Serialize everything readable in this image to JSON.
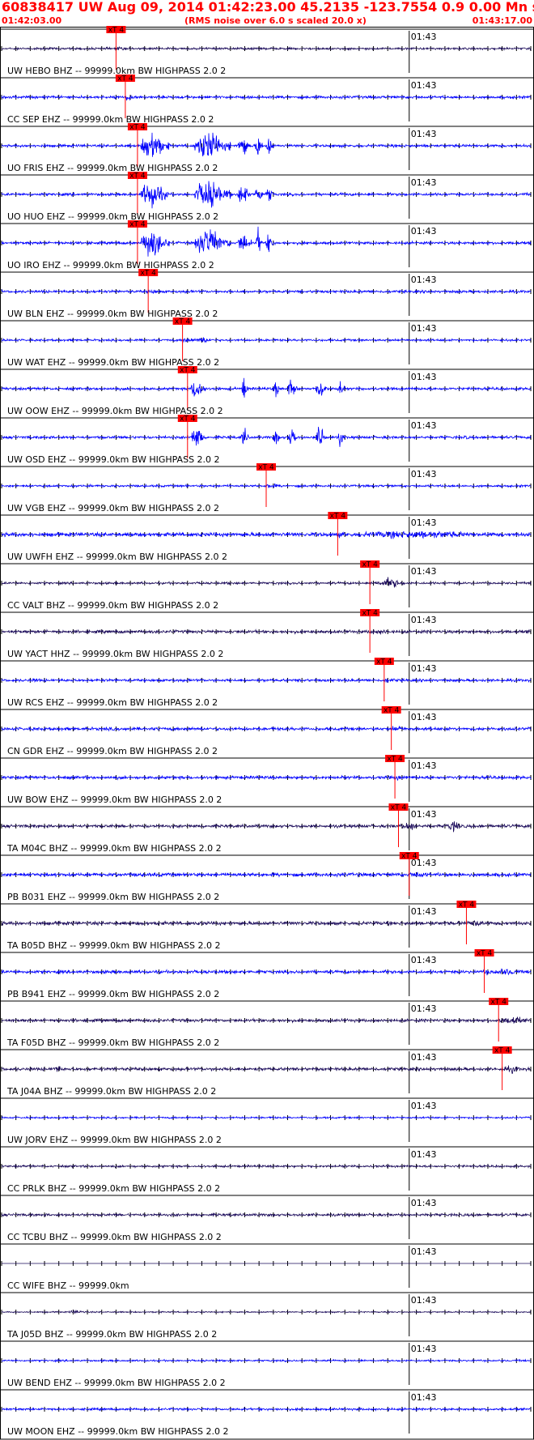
{
  "header": {
    "title": "60838417 UW Aug 09, 2014 01:42:23.00   45.2135 -123.7554  0.9 0.00 Mn st --- -- --   -1",
    "start_time": "01:42:03.00",
    "subtitle": "(RMS noise over 6.0 s scaled 20.0 x)",
    "end_time": "01:43:17.00"
  },
  "colors": {
    "header_text": "#ff0000",
    "trace_blue": "#0000ff",
    "trace_dark": "#1a0a5a",
    "pick_marker": "#ff0000",
    "grid": "#000000"
  },
  "chart_data": {
    "type": "line",
    "title": "60838417 UW Aug 09, 2014 01:42:23.00   45.2135 -123.7554  0.9 0.00 Mn st --- -- --   -1",
    "xlabel": "",
    "ylabel": "",
    "x_range_seconds": [
      0,
      74
    ],
    "x_start_label": "01:42:03.00",
    "x_end_label": "01:43:17.00",
    "minute_tick_label": "01:43",
    "minute_tick_offset_s": 57,
    "tick_spacing_s": 2,
    "grid": false,
    "pick_label": "xT 4",
    "traces": [
      {
        "label": "UW HEBO BHZ -- 99999.0km BW  HIGHPASS  2.0  2",
        "color": "dark",
        "pick_s": 16.0,
        "amp": 0.25,
        "bursts": [],
        "pick_burst": 0.2
      },
      {
        "label": "CC SEP EHZ -- 99999.0km BW  HIGHPASS  2.0  2",
        "color": "blue",
        "pick_s": 17.3,
        "amp": 0.3,
        "bursts": [],
        "pick_burst": 0.6
      },
      {
        "label": "UO FRIS EHZ -- 99999.0km BW  HIGHPASS  2.0  2",
        "color": "blue",
        "pick_s": 19.0,
        "amp": 0.3,
        "bursts": [
          [
            19.5,
            23.5,
            3.5
          ],
          [
            27,
            32,
            3.5
          ],
          [
            33,
            35,
            2.5
          ],
          [
            35.5,
            36.5,
            3
          ],
          [
            37,
            38,
            2.5
          ]
        ],
        "pick_burst": 0
      },
      {
        "label": "UO HUO EHZ -- 99999.0km BW  HIGHPASS  2.0  2",
        "color": "blue",
        "pick_s": 19.0,
        "amp": 0.3,
        "bursts": [
          [
            19.5,
            23.5,
            3.5
          ],
          [
            27,
            32,
            3.5
          ],
          [
            33,
            35,
            2.5
          ],
          [
            35.5,
            36.5,
            3
          ],
          [
            37,
            38,
            2.5
          ]
        ],
        "pick_burst": 0
      },
      {
        "label": "UO IRO EHZ -- 99999.0km BW  HIGHPASS  2.0  2",
        "color": "blue",
        "pick_s": 19.0,
        "amp": 0.3,
        "bursts": [
          [
            19.5,
            23.5,
            3.5
          ],
          [
            27,
            32,
            3.5
          ],
          [
            33,
            35,
            2.5
          ],
          [
            35.5,
            36.5,
            3
          ],
          [
            37,
            38,
            2.5
          ]
        ],
        "pick_burst": 0
      },
      {
        "label": "UW BLN EHZ -- 99999.0km BW  HIGHPASS  2.0  2",
        "color": "blue",
        "pick_s": 20.5,
        "amp": 0.3,
        "bursts": [],
        "pick_burst": 0.3
      },
      {
        "label": "UW WAT EHZ -- 99999.0km BW  HIGHPASS  2.0  2",
        "color": "blue",
        "pick_s": 25.3,
        "amp": 0.25,
        "bursts": [
          [
            27,
            30,
            0.8
          ]
        ],
        "pick_burst": 0.5
      },
      {
        "label": "UW OOW EHZ -- 99999.0km BW  HIGHPASS  2.0  2",
        "color": "blue",
        "pick_s": 26.0,
        "amp": 0.3,
        "bursts": [
          [
            26.5,
            28.5,
            3
          ],
          [
            33.5,
            34.5,
            2.5
          ],
          [
            38,
            39,
            2
          ],
          [
            40,
            41.5,
            2.5
          ],
          [
            44,
            45.5,
            3
          ],
          [
            47,
            48,
            2
          ]
        ],
        "pick_burst": 0
      },
      {
        "label": "UW OSD EHZ -- 99999.0km BW  HIGHPASS  2.0  2",
        "color": "blue",
        "pick_s": 26.0,
        "amp": 0.3,
        "bursts": [
          [
            26.5,
            28.5,
            3
          ],
          [
            33.5,
            34.5,
            2.5
          ],
          [
            38,
            39,
            2
          ],
          [
            40,
            41.5,
            2.5
          ],
          [
            44,
            45.5,
            3
          ],
          [
            47,
            48,
            2
          ],
          [
            64.5,
            65.5,
            0.6
          ]
        ],
        "pick_burst": 0
      },
      {
        "label": "UW VGB EHZ -- 99999.0km BW  HIGHPASS  2.0  2",
        "color": "blue",
        "pick_s": 37.0,
        "amp": 0.25,
        "bursts": [],
        "pick_burst": 0.5
      },
      {
        "label": "UW UWFH EHZ -- 99999.0km BW  HIGHPASS  2.0  2",
        "color": "blue",
        "pick_s": 47.0,
        "amp": 0.45,
        "bursts": [
          [
            47.5,
            74,
            0.9
          ]
        ],
        "pick_burst": 0.3
      },
      {
        "label": "CC VALT BHZ -- 99999.0km BW  HIGHPASS  2.0  2",
        "color": "dark",
        "pick_s": 51.5,
        "amp": 0.25,
        "bursts": [
          [
            52.5,
            57,
            1.2
          ]
        ],
        "pick_burst": 0.3
      },
      {
        "label": "UW YACT HHZ -- 99999.0km BW  HIGHPASS  2.0  2",
        "color": "dark",
        "pick_s": 51.5,
        "amp": 0.35,
        "bursts": [
          [
            52,
            55,
            0.6
          ]
        ],
        "pick_burst": 0.3
      },
      {
        "label": "UW RCS EHZ -- 99999.0km BW  HIGHPASS  2.0  2",
        "color": "blue",
        "pick_s": 53.5,
        "amp": 0.3,
        "bursts": [
          [
            4,
            6,
            0.5
          ]
        ],
        "pick_burst": 0.3
      },
      {
        "label": "CN GDR EHZ -- 99999.0km BW  HIGHPASS  2.0  2",
        "color": "blue",
        "pick_s": 54.5,
        "amp": 0.35,
        "bursts": [
          [
            55,
            57,
            0.7
          ],
          [
            59,
            61,
            0.5
          ]
        ],
        "pick_burst": 0.3
      },
      {
        "label": "UW BOW EHZ -- 99999.0km BW  HIGHPASS  2.0  2",
        "color": "blue",
        "pick_s": 55.0,
        "amp": 0.35,
        "bursts": [],
        "pick_burst": 0.3
      },
      {
        "label": "TA M04C BHZ -- 99999.0km BW  HIGHPASS  2.0  2",
        "color": "dark",
        "pick_s": 55.5,
        "amp": 0.35,
        "bursts": [
          [
            56,
            59,
            1.0
          ],
          [
            62,
            65,
            1.2
          ]
        ],
        "pick_burst": 0.3
      },
      {
        "label": "PB B031 EHZ -- 99999.0km BW  HIGHPASS  2.0  2",
        "color": "blue",
        "pick_s": 57.0,
        "amp": 0.4,
        "bursts": [
          [
            57.5,
            60,
            0.8
          ]
        ],
        "pick_burst": 0.3
      },
      {
        "label": "TA B05D BHZ -- 99999.0km BW  HIGHPASS  2.0  2",
        "color": "dark",
        "pick_s": 65.0,
        "amp": 0.4,
        "bursts": [
          [
            65.5,
            68,
            1.0
          ]
        ],
        "pick_burst": 0.3
      },
      {
        "label": "PB B941 EHZ -- 99999.0km BW  HIGHPASS  2.0  2",
        "color": "blue",
        "pick_s": 67.5,
        "amp": 0.35,
        "bursts": [
          [
            68,
            74,
            0.8
          ]
        ],
        "pick_burst": 0.3
      },
      {
        "label": "TA F05D BHZ -- 99999.0km BW  HIGHPASS  2.0  2",
        "color": "dark",
        "pick_s": 69.5,
        "amp": 0.35,
        "bursts": [
          [
            70,
            74,
            1.0
          ]
        ],
        "pick_burst": 0.3
      },
      {
        "label": "TA J04A BHZ -- 99999.0km BW  HIGHPASS  2.0  2",
        "color": "dark",
        "pick_s": 70.0,
        "amp": 0.35,
        "bursts": [
          [
            7,
            9,
            0.9
          ],
          [
            70.5,
            73,
            0.9
          ]
        ],
        "pick_burst": 0.3
      },
      {
        "label": "UW JORV EHZ -- 99999.0km BW  HIGHPASS  2.0  2",
        "color": "blue",
        "pick_s": null,
        "amp": 0.2,
        "bursts": [],
        "pick_burst": 0
      },
      {
        "label": "CC PRLK BHZ -- 99999.0km BW  HIGHPASS  2.0  2",
        "color": "dark",
        "pick_s": null,
        "amp": 0.25,
        "bursts": [],
        "pick_burst": 0
      },
      {
        "label": "CC TCBU BHZ -- 99999.0km BW  HIGHPASS  2.0  2",
        "color": "dark",
        "pick_s": null,
        "amp": 0.3,
        "bursts": [],
        "pick_burst": 0
      },
      {
        "label": "CC WIFE BHZ -- 99999.0km",
        "color": "dark",
        "pick_s": null,
        "amp": 0.0,
        "bursts": [],
        "pick_burst": 0
      },
      {
        "label": "TA J05D BHZ -- 99999.0km BW  HIGHPASS  2.0  2",
        "color": "dark",
        "pick_s": null,
        "amp": 0.15,
        "bursts": [
          [
            9,
            13,
            0.4
          ]
        ],
        "pick_burst": 0
      },
      {
        "label": "UW BEND EHZ -- 99999.0km BW  HIGHPASS  2.0  2",
        "color": "blue",
        "pick_s": null,
        "amp": 0.2,
        "bursts": [],
        "pick_burst": 0
      },
      {
        "label": "UW MOON EHZ -- 99999.0km BW  HIGHPASS  2.0  2",
        "color": "blue",
        "pick_s": null,
        "amp": 0.25,
        "bursts": [],
        "pick_burst": 0
      }
    ]
  }
}
